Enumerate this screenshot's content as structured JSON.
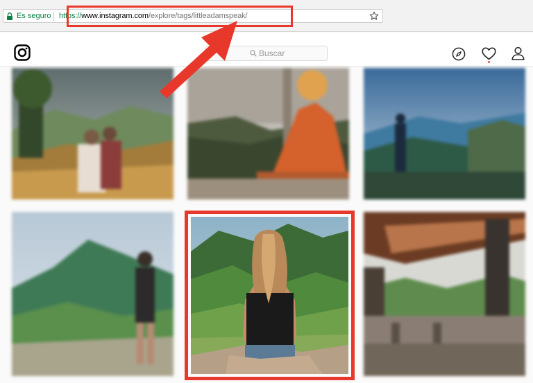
{
  "browser": {
    "secure_label": "Es seguro",
    "url_scheme": "https://",
    "url_host": "www.instagram.com",
    "url_path": "/explore/tags/littleadamspeak/",
    "secure_color": "#0b8043"
  },
  "instagram": {
    "search_placeholder": "Buscar",
    "icons": [
      "instagram-logo-icon",
      "search-icon",
      "compass-icon",
      "heart-icon",
      "profile-icon"
    ]
  },
  "annotations": {
    "color": "#e8382b",
    "url_box": "highlight around URL",
    "arrow": "arrow pointing to URL",
    "photo_box": "highlight around center photo"
  },
  "grid": {
    "photos": [
      {
        "id": "photo-1",
        "subject": "two people on hillside trail",
        "blurred": true
      },
      {
        "id": "photo-2",
        "subject": "buddha statue over mountains",
        "blurred": true
      },
      {
        "id": "photo-3",
        "subject": "person standing above valley",
        "blurred": true
      },
      {
        "id": "photo-4",
        "subject": "person facing green mountain",
        "blurred": true
      },
      {
        "id": "photo-5",
        "subject": "woman sitting on rock facing hills",
        "blurred": false,
        "highlighted": true
      },
      {
        "id": "photo-6",
        "subject": "view from veranda with roof",
        "blurred": true
      }
    ]
  }
}
